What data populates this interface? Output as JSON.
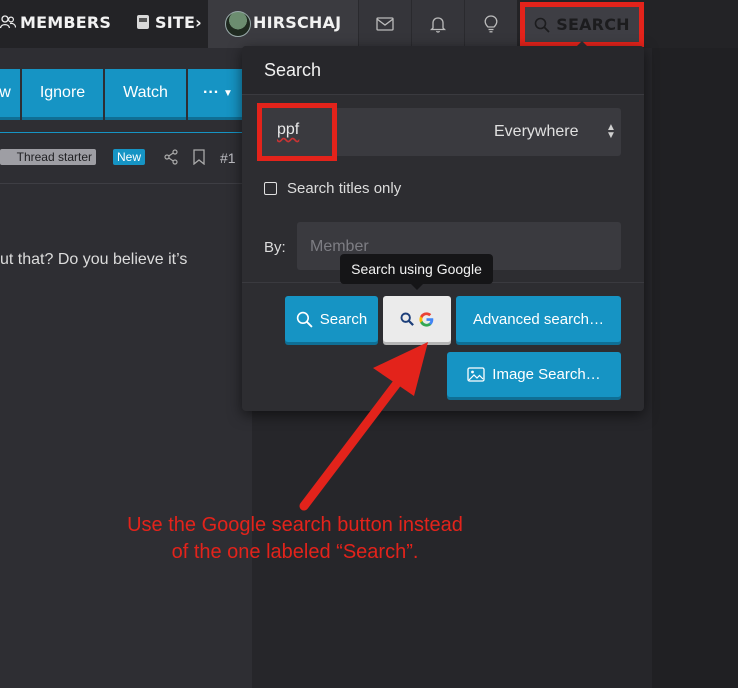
{
  "nav": {
    "members_label": "MEMBERS",
    "site_label": "SITE",
    "user_label": "HIRSCHAJ",
    "search_label": "SEARCH",
    "icons": [
      "envelope-icon",
      "bell-icon",
      "lightbulb-icon",
      "search-icon"
    ]
  },
  "thread": {
    "toolbar": {
      "partial_label": "w",
      "ignore_label": "Ignore",
      "watch_label": "Watch",
      "more_label": "···"
    },
    "starter_badge": "Thread starter",
    "new_badge": "New",
    "post_number": "#1",
    "post_text": "ut that? Do you believe it’s"
  },
  "search_panel": {
    "title": "Search",
    "query_value": "ppf",
    "scope_value": "Everywhere",
    "titles_only_label": "Search titles only",
    "titles_only_checked": false,
    "by_label": "By:",
    "member_placeholder": "Member",
    "tooltip": "Search using Google",
    "search_button": "Search",
    "advanced_button": "Advanced search…",
    "image_button": "Image Search…"
  },
  "annotation": {
    "line1": "Use the Google search button instead",
    "line2": "of the one labeled “Search”."
  },
  "colors": {
    "accent": "#1694c4",
    "highlight_red": "#e3231b",
    "background": "#2b2b2f",
    "panel": "#2d2d31"
  }
}
